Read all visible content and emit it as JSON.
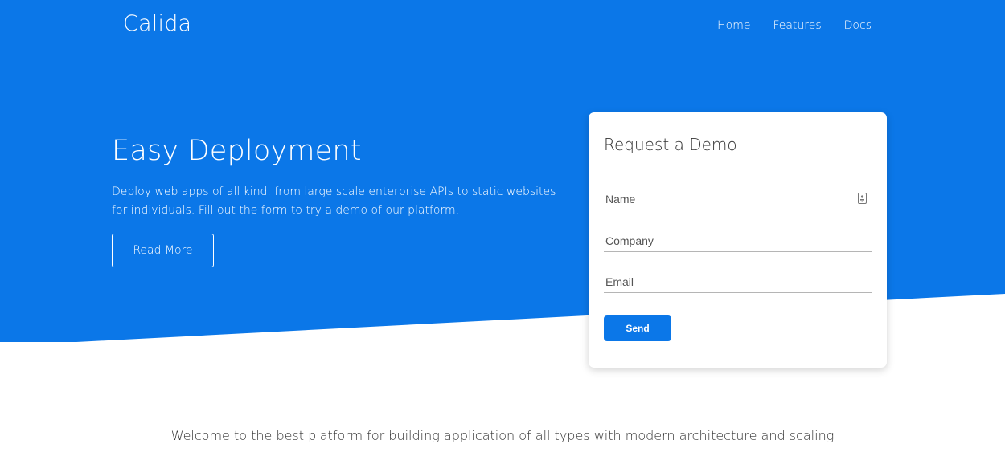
{
  "colors": {
    "hero": "#0b77e8",
    "white": "#ffffff",
    "text": "#333333"
  },
  "nav": {
    "brand": "Calida",
    "links": [
      "Home",
      "Features",
      "Docs"
    ]
  },
  "hero": {
    "title": "Easy Deployment",
    "description": "Deploy web apps of all kind, from large scale enterprise APIs to static websites for individuals. Fill out the form to try a demo of our platform.",
    "button_label": "Read More"
  },
  "form": {
    "title": "Request a Demo",
    "fields": [
      {
        "placeholder": "Name",
        "value": "",
        "icon": "contact-card-icon"
      },
      {
        "placeholder": "Company",
        "value": ""
      },
      {
        "placeholder": "Email",
        "value": ""
      }
    ],
    "submit_label": "Send"
  },
  "welcome": "Welcome to the best platform for building application of all types with modern architecture and scaling"
}
